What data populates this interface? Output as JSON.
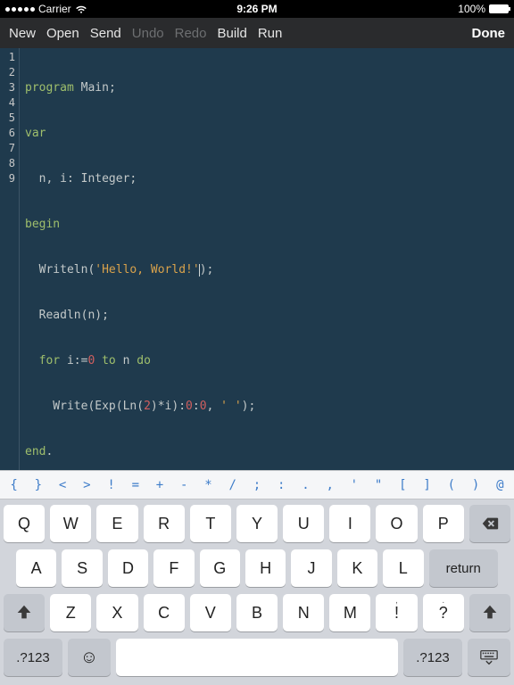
{
  "status": {
    "carrier": "Carrier",
    "time": "9:26 PM",
    "battery": "100%"
  },
  "toolbar": {
    "new": "New",
    "open": "Open",
    "send": "Send",
    "undo": "Undo",
    "redo": "Redo",
    "build": "Build",
    "run": "Run",
    "done": "Done"
  },
  "code": {
    "lines": [
      "1",
      "2",
      "3",
      "4",
      "5",
      "6",
      "7",
      "8",
      "9"
    ],
    "l1_kw": "program",
    "l1_sp": " ",
    "l1_id": "Main",
    "l1_sc": ";",
    "l2_kw": "var",
    "l3": "  n, i: Integer;",
    "l4_kw": "begin",
    "l5_a": "  Writeln(",
    "l5_str": "'Hello, World!'",
    "l5_b": ");",
    "l6": "  Readln(n);",
    "l7_a": "  ",
    "l7_for": "for",
    "l7_b": " i:=",
    "l7_zero": "0",
    "l7_c": " ",
    "l7_to": "to",
    "l7_d": " n ",
    "l7_do": "do",
    "l8_a": "    Write(Exp(Ln(",
    "l8_two": "2",
    "l8_b": ")*i):",
    "l8_z1": "0",
    "l8_c": ":",
    "l8_z2": "0",
    "l8_d": ", ",
    "l8_s": "' '",
    "l8_e": ");",
    "l9_kw": "end",
    "l9_dot": "."
  },
  "symbols": [
    "{",
    "}",
    "<",
    ">",
    "!",
    "=",
    "+",
    "-",
    "*",
    "/",
    ";",
    ":",
    ".",
    ",",
    "'",
    "\"",
    "[",
    "]",
    "(",
    ")",
    "@"
  ],
  "keyboard": {
    "row1": [
      "Q",
      "W",
      "E",
      "R",
      "T",
      "Y",
      "U",
      "I",
      "O",
      "P"
    ],
    "row2": [
      "A",
      "S",
      "D",
      "F",
      "G",
      "H",
      "J",
      "K",
      "L"
    ],
    "row3_end": [
      {
        "main": "!",
        "top": ","
      },
      {
        "main": "?",
        "top": "."
      }
    ],
    "row3": [
      "Z",
      "X",
      "C",
      "V",
      "B",
      "N",
      "M"
    ],
    "num": ".?123",
    "return": "return"
  }
}
